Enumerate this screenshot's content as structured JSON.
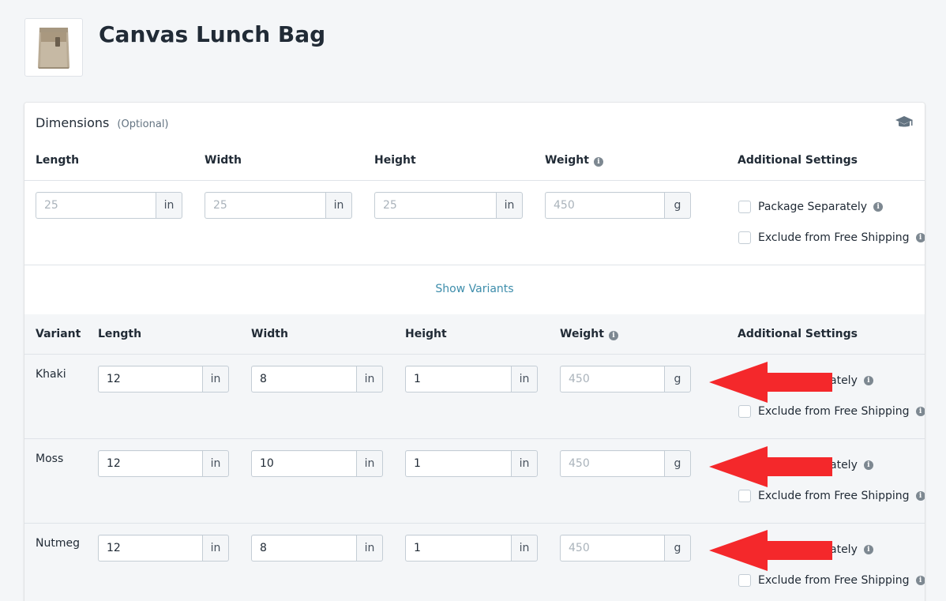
{
  "product": {
    "title": "Canvas Lunch Bag",
    "thumbnail_icon": "lunch-bag-image"
  },
  "dimensions": {
    "title": "Dimensions",
    "optional_label": "(Optional)",
    "help_icon": "graduation-cap-icon",
    "columns": {
      "length": "Length",
      "width": "Width",
      "height": "Height",
      "weight": "Weight",
      "additional": "Additional Settings"
    },
    "defaults": {
      "length": {
        "placeholder": "25",
        "unit": "in"
      },
      "width": {
        "placeholder": "25",
        "unit": "in"
      },
      "height": {
        "placeholder": "25",
        "unit": "in"
      },
      "weight": {
        "placeholder": "450",
        "unit": "g"
      },
      "package_separately": "Package Separately",
      "exclude_free_shipping": "Exclude from Free Shipping"
    },
    "show_variants_link": "Show Variants"
  },
  "variants_table": {
    "columns": {
      "variant": "Variant",
      "length": "Length",
      "width": "Width",
      "height": "Height",
      "weight": "Weight",
      "additional": "Additional Settings"
    },
    "rows": [
      {
        "name": "Khaki",
        "length": "12",
        "width": "8",
        "height": "1",
        "weight_placeholder": "450",
        "length_unit": "in",
        "width_unit": "in",
        "height_unit": "in",
        "weight_unit": "g",
        "package_separately_partial": "ately",
        "exclude_free_shipping": "Exclude from Free Shipping"
      },
      {
        "name": "Moss",
        "length": "12",
        "width": "10",
        "height": "1",
        "weight_placeholder": "450",
        "length_unit": "in",
        "width_unit": "in",
        "height_unit": "in",
        "weight_unit": "g",
        "package_separately_partial": "ately",
        "exclude_free_shipping": "Exclude from Free Shipping"
      },
      {
        "name": "Nutmeg",
        "length": "12",
        "width": "8",
        "height": "1",
        "weight_placeholder": "450",
        "length_unit": "in",
        "width_unit": "in",
        "height_unit": "in",
        "weight_unit": "g",
        "package_separately_partial": "ately",
        "exclude_free_shipping": "Exclude from Free Shipping"
      }
    ]
  },
  "colors": {
    "link": "#3d8dab",
    "arrow": "#f4282b",
    "background": "#f4f6f8"
  }
}
